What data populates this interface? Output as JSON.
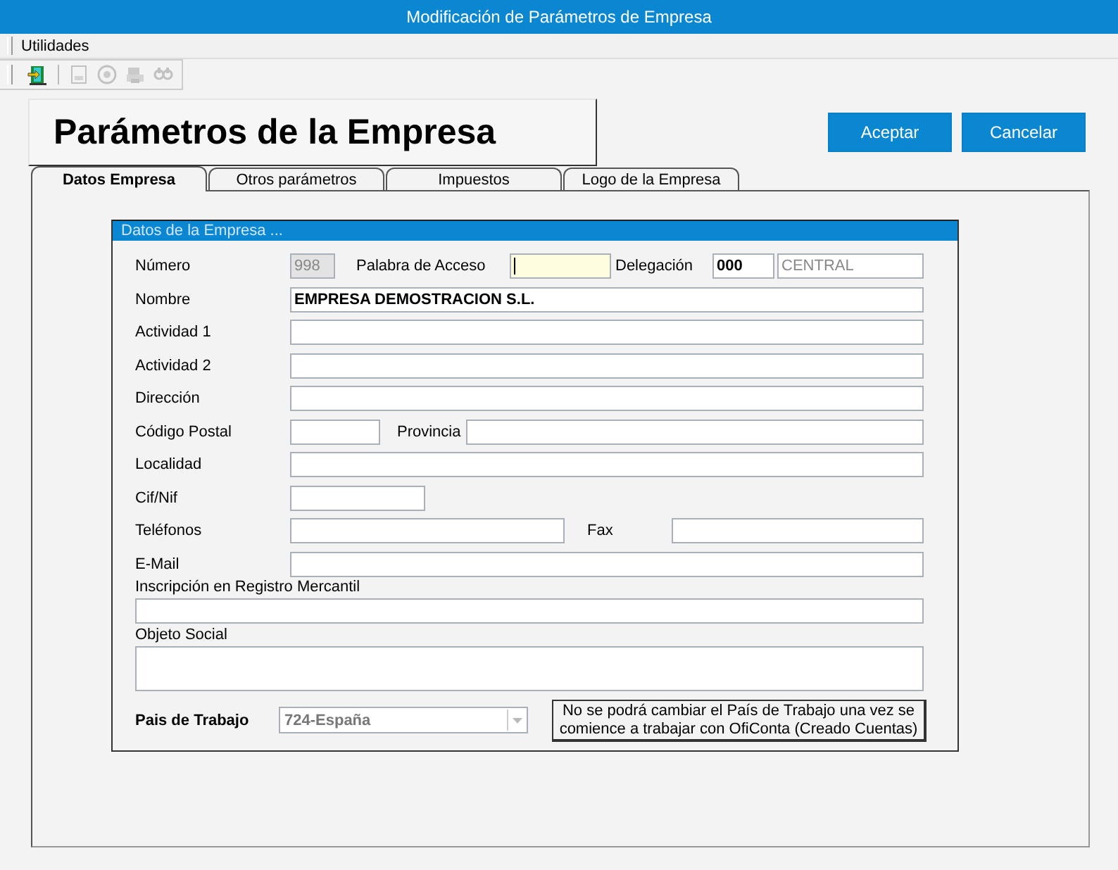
{
  "window": {
    "title": "Modificación de Parámetros de Empresa"
  },
  "menu": [
    {
      "label": "Utilidades"
    }
  ],
  "toolbar": [
    {
      "kind": "exit",
      "disabled": false
    },
    {
      "kind": "page",
      "disabled": true
    },
    {
      "kind": "view",
      "disabled": true
    },
    {
      "kind": "print",
      "disabled": true
    },
    {
      "kind": "search",
      "disabled": true
    }
  ],
  "header": {
    "title": "Parámetros de la Empresa"
  },
  "buttons": [
    {
      "label": "Aceptar"
    },
    {
      "label": "Cancelar"
    }
  ],
  "tabs": [
    {
      "label": "Datos Empresa",
      "selected": true
    },
    {
      "label": "Otros parámetros",
      "selected": false
    },
    {
      "label": "Impuestos",
      "selected": false
    },
    {
      "label": "Logo de la Empresa",
      "selected": false
    }
  ],
  "group": {
    "title": "Datos de la Empresa ...",
    "rows": [
      {
        "kind": "inline",
        "items": [
          {
            "kind": "label",
            "text": "Número"
          },
          {
            "kind": "field",
            "value": "998",
            "readonly": true,
            "disabled": true,
            "focused": false,
            "bold": false
          },
          {
            "kind": "label",
            "text": "Palabra de Acceso"
          },
          {
            "kind": "field",
            "readonly": false,
            "focused": true
          },
          {
            "kind": "label",
            "text": "Delegación"
          },
          {
            "kind": "field",
            "value": "000",
            "readonly": false,
            "disabled": false,
            "focused": false,
            "bold": true
          },
          {
            "kind": "field",
            "value": "CENTRAL",
            "readonly": false,
            "disabled": true,
            "focused": false,
            "bold": false
          }
        ]
      },
      {
        "kind": "inline",
        "items": [
          {
            "kind": "label",
            "text": "Nombre"
          },
          {
            "kind": "field",
            "value": "EMPRESA DEMOSTRACION S.L.",
            "readonly": false,
            "disabled": false,
            "focused": false,
            "bold": true
          }
        ]
      },
      {
        "kind": "inline",
        "items": [
          {
            "kind": "label",
            "text": "Actividad 1"
          },
          {
            "kind": "field",
            "readonly": false,
            "focused": false
          }
        ]
      },
      {
        "kind": "inline",
        "items": [
          {
            "kind": "label",
            "text": "Actividad 2"
          },
          {
            "kind": "field",
            "readonly": false,
            "focused": false
          }
        ]
      },
      {
        "kind": "inline",
        "items": [
          {
            "kind": "label",
            "text": "Dirección"
          },
          {
            "kind": "field",
            "readonly": false,
            "focused": false
          }
        ]
      },
      {
        "kind": "inline",
        "items": [
          {
            "kind": "label",
            "text": "Código Postal"
          },
          {
            "kind": "field",
            "readonly": false,
            "focused": false
          },
          {
            "kind": "label",
            "text": "Provincia"
          },
          {
            "kind": "field",
            "readonly": false,
            "focused": false
          }
        ]
      },
      {
        "kind": "inline",
        "items": [
          {
            "kind": "label",
            "text": "Localidad"
          },
          {
            "kind": "field",
            "readonly": false,
            "focused": false
          }
        ]
      },
      {
        "kind": "inline",
        "items": [
          {
            "kind": "label",
            "text": "Cif/Nif"
          },
          {
            "kind": "field",
            "readonly": false,
            "focused": false
          }
        ]
      },
      {
        "kind": "inline",
        "items": [
          {
            "kind": "label",
            "text": "Teléfonos"
          },
          {
            "kind": "field",
            "readonly": false,
            "focused": false
          },
          {
            "kind": "label",
            "text": "Fax"
          },
          {
            "kind": "field",
            "readonly": false,
            "focused": false
          }
        ]
      },
      {
        "kind": "inline",
        "items": [
          {
            "kind": "label",
            "text": "E-Mail"
          },
          {
            "kind": "field",
            "readonly": false,
            "focused": false
          }
        ]
      },
      {
        "kind": "stacked",
        "items": [
          {
            "kind": "label",
            "text": "Inscripción en Registro Mercantil"
          },
          {
            "kind": "field",
            "readonly": false,
            "focused": false
          }
        ]
      },
      {
        "kind": "stacked",
        "items": [
          {
            "kind": "label",
            "text": "Objeto Social"
          },
          {
            "kind": "area",
            "readonly": false,
            "focused": false
          }
        ]
      }
    ]
  },
  "country": {
    "label": "Pais de Trabajo",
    "value": "724-España",
    "disabled": true
  },
  "notice": "No se podrá cambiar el País de Trabajo una vez se comience a trabajar con OfiConta (Creado Cuentas)"
}
